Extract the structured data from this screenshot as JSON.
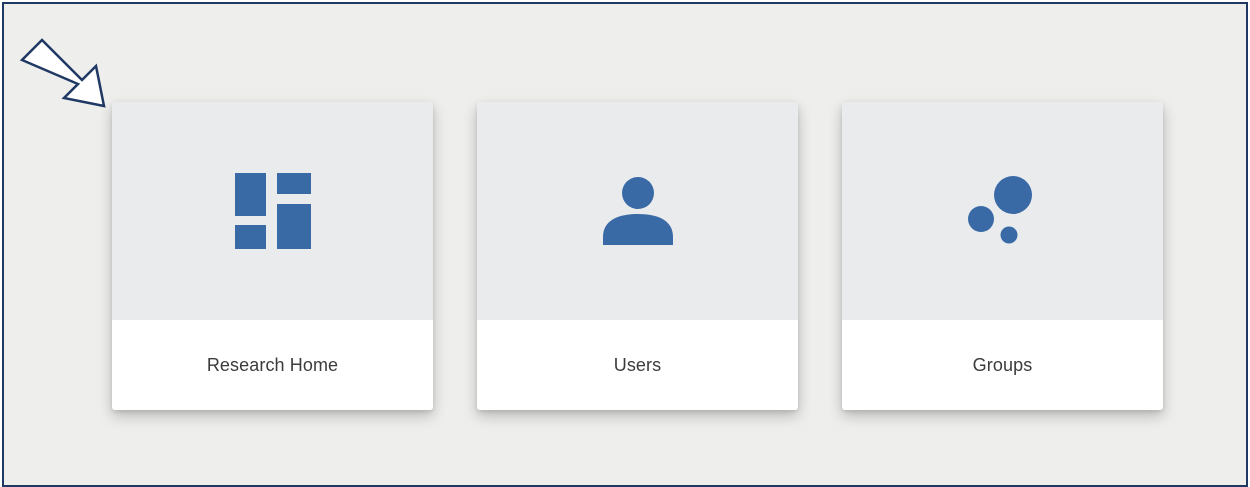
{
  "colors": {
    "background": "#eeeeec",
    "frame_border": "#1f3864",
    "icon": "#3a6aa6",
    "tile_top": "#eaebed",
    "tile_bottom": "#ffffff",
    "label": "#3c3c3c"
  },
  "pointer": {
    "icon": "outline-arrow-icon"
  },
  "tiles": [
    {
      "label": "Research Home",
      "icon": "dashboard-icon"
    },
    {
      "label": "Users",
      "icon": "user-icon"
    },
    {
      "label": "Groups",
      "icon": "bubbles-icon"
    }
  ]
}
